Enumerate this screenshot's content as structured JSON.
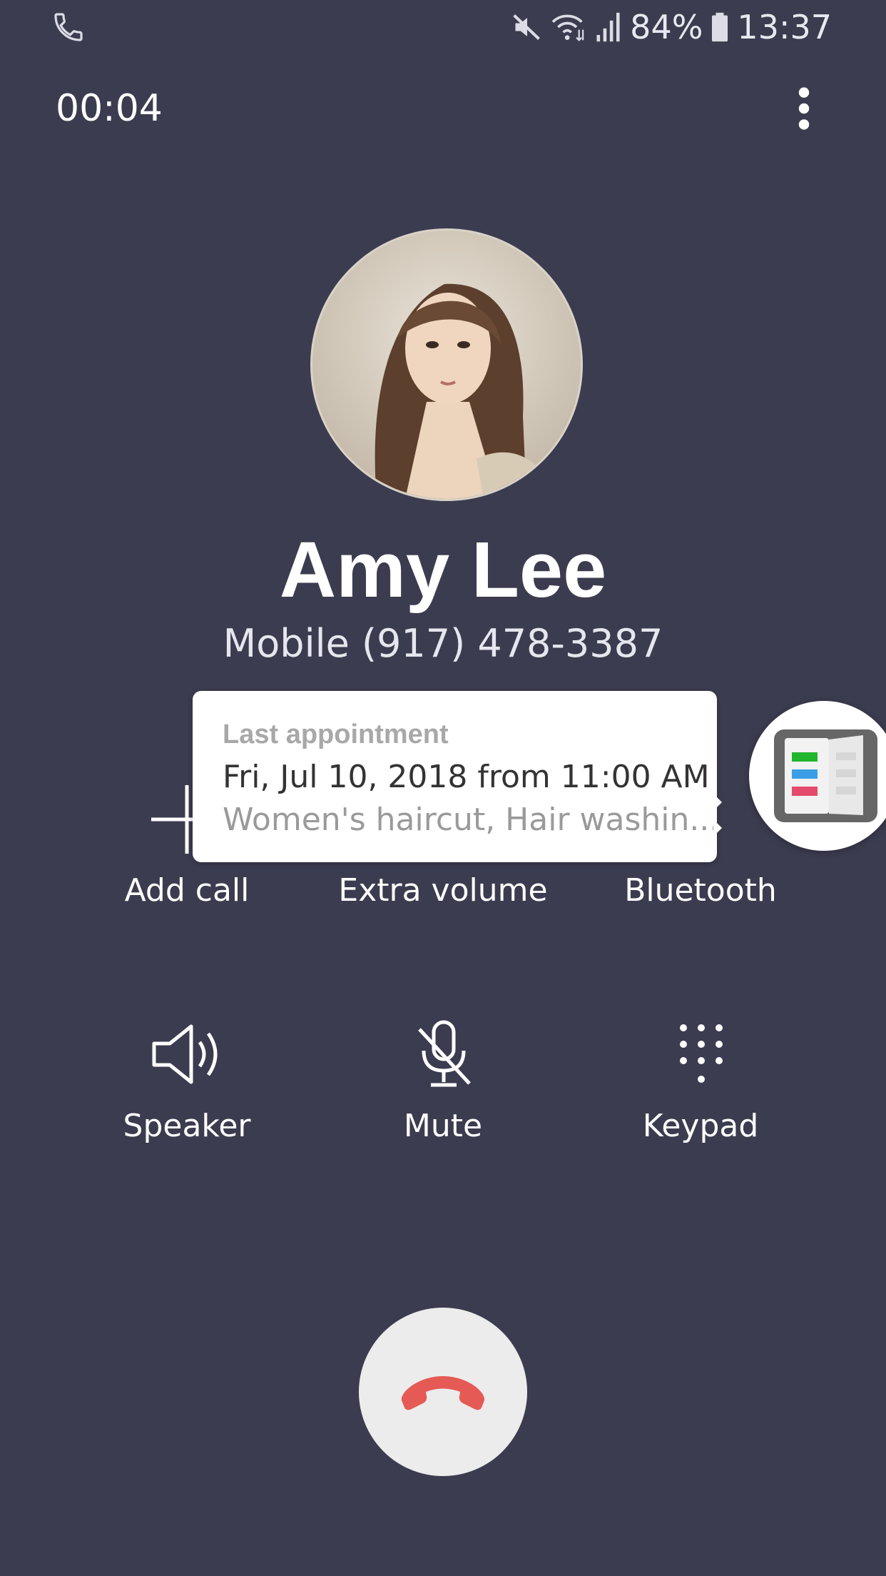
{
  "status_bar": {
    "battery": "84%",
    "time": "13:37",
    "icons": [
      "phone-icon",
      "mute-icon",
      "wifi-icon",
      "signal-icon",
      "battery-icon"
    ]
  },
  "call": {
    "timer": "00:04",
    "contact_name": "Amy Lee",
    "number_line": "Mobile  (917) 478-3387"
  },
  "popup": {
    "title": "Last appointment",
    "date": "Fri, Jul 10, 2018 from 11:00 AM",
    "detail": "Women's haircut, Hair washin..."
  },
  "controls": {
    "add_call": "Add call",
    "extra_volume": "Extra volume",
    "bluetooth": "Bluetooth",
    "speaker": "Speaker",
    "mute": "Mute",
    "keypad": "Keypad"
  },
  "colors": {
    "background": "#3c3c50",
    "end_call": "#e55a54"
  }
}
